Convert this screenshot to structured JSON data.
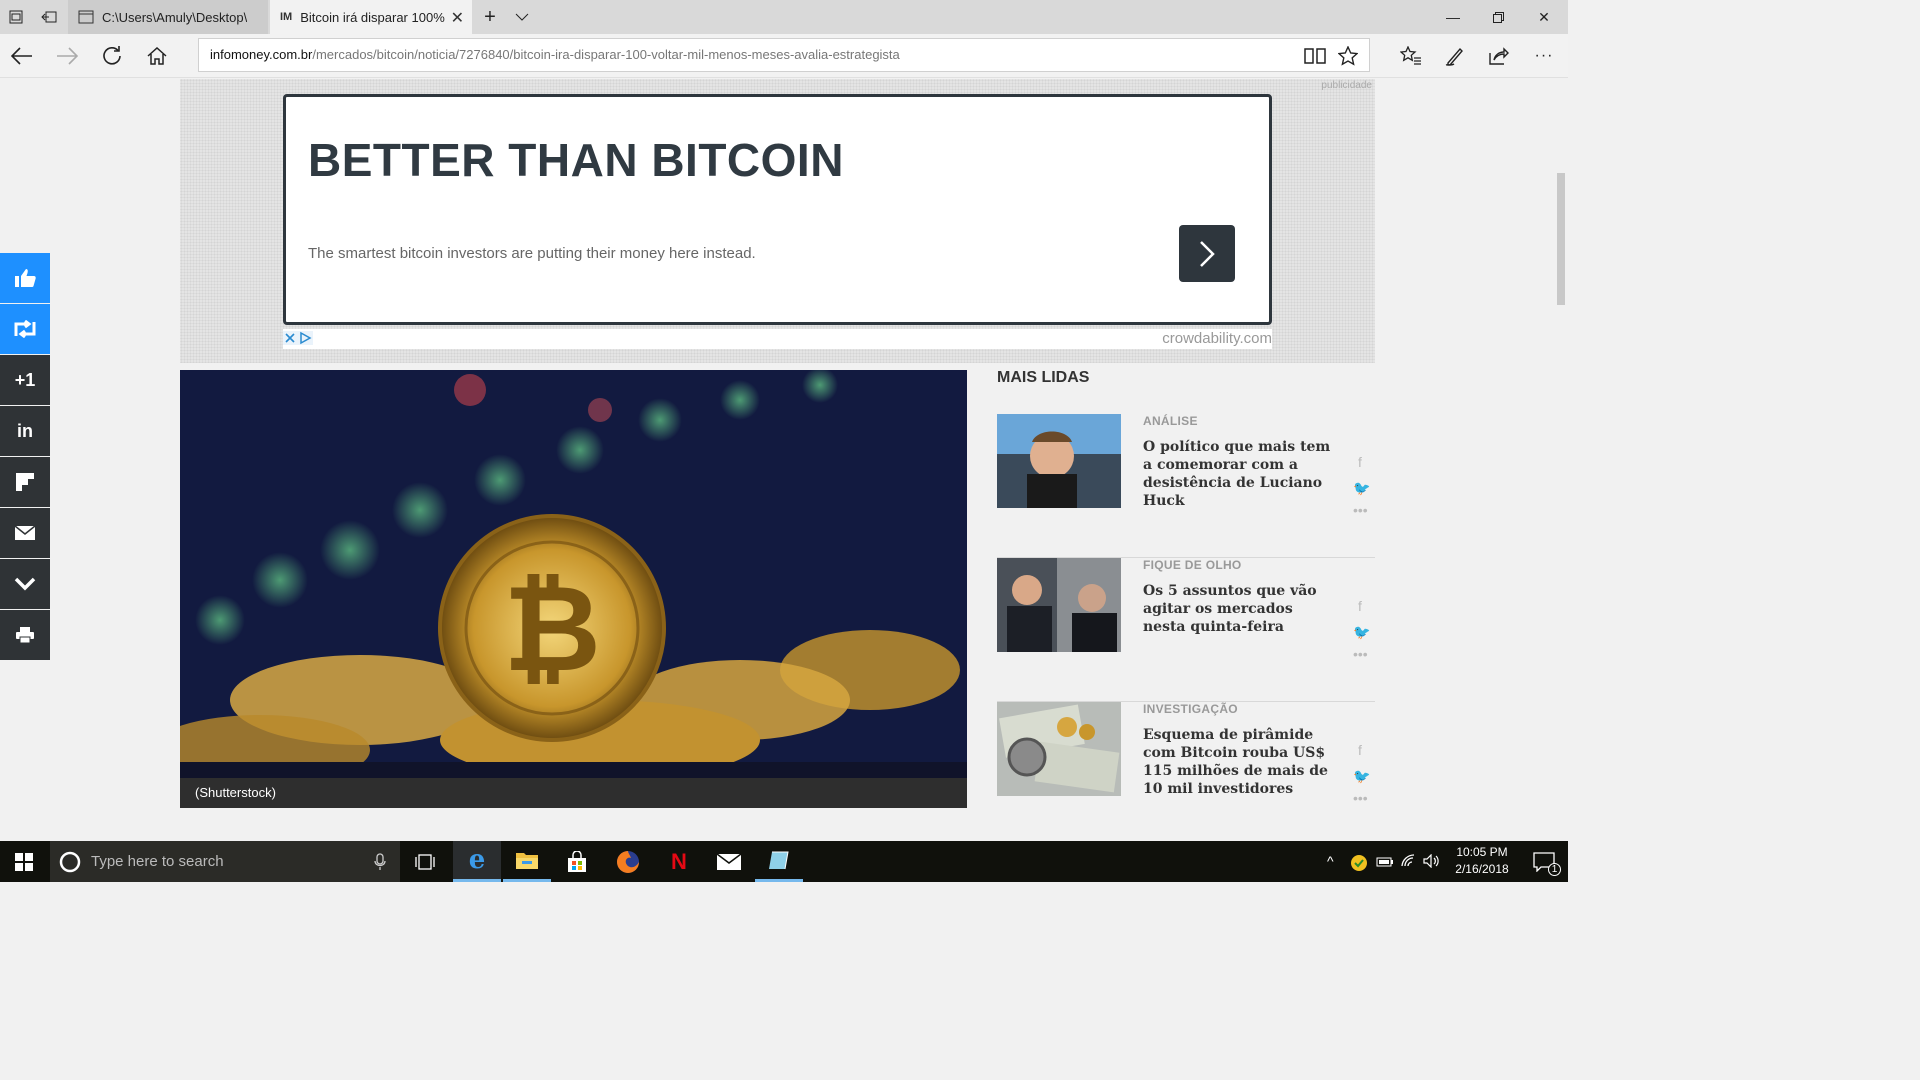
{
  "browser": {
    "tabs": [
      {
        "label": "C:\\Users\\Amuly\\Desktop\\lal",
        "favicon": "page-icon",
        "active": false
      },
      {
        "label": "Bitcoin irá disparar 100%",
        "favicon": "IM",
        "active": true
      }
    ],
    "url_domain": "infomoney.com.br",
    "url_path": "/mercados/bitcoin/noticia/7276840/bitcoin-ira-disparar-100-voltar-mil-menos-meses-avalia-estrategista"
  },
  "ad": {
    "publicidade": "publicidade",
    "title": "BETTER THAN BITCOIN",
    "text": "The smartest bitcoin investors are putting their money here instead.",
    "source": "crowdability.com"
  },
  "share": {
    "items": [
      "like",
      "retweet",
      "+1",
      "in",
      "flipboard",
      "email",
      "more",
      "print"
    ],
    "plus_one": "+1",
    "linkedin": "in"
  },
  "article": {
    "caption": "(Shutterstock)"
  },
  "mais_lidas": {
    "title": "MAIS LIDAS",
    "items": [
      {
        "category": "ANÁLISE",
        "headline": "O político que mais tem a comemorar com a desistência de Luciano Huck"
      },
      {
        "category": "FIQUE DE OLHO",
        "headline": "Os 5 assuntos que vão agitar os mercados nesta quinta-feira"
      },
      {
        "category": "INVESTIGAÇÃO",
        "headline": "Esquema de pirâmide com Bitcoin rouba US$ 115 milhões de mais de 10 mil investidores"
      }
    ]
  },
  "taskbar": {
    "search_placeholder": "Type here to search",
    "time": "10:05 PM",
    "date": "2/16/2018",
    "notifications": "1"
  },
  "colors": {
    "share_bar": "#2f3336",
    "share_active": "#1e90ff",
    "ad_dark": "#2e363d"
  }
}
